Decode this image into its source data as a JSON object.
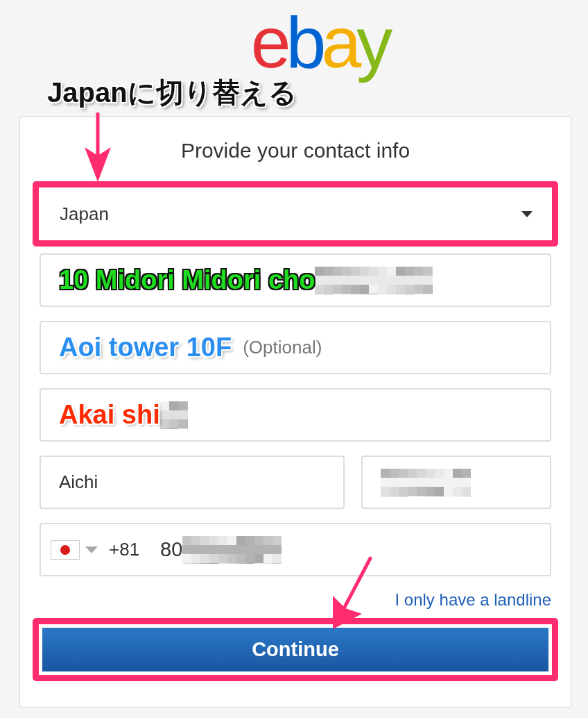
{
  "logo": {
    "letters": [
      {
        "text": "e",
        "color": "#e53238"
      },
      {
        "text": "b",
        "color": "#0064d2"
      },
      {
        "text": "a",
        "color": "#f5af02"
      },
      {
        "text": "y",
        "color": "#86b817"
      }
    ]
  },
  "annotation_title": "Japanに切り替える",
  "title": "Provide your contact info",
  "country_select": {
    "value": "Japan",
    "highlighted": true
  },
  "address_fields": [
    {
      "annotation": {
        "text": "10 Midori Midori cho",
        "color": "#1fdd1f"
      },
      "blurred": true
    },
    {
      "annotation": {
        "text": "Aoi tower 10F",
        "color": "#2b8ff0"
      },
      "placeholder": "(Optional)",
      "blurred": false
    },
    {
      "annotation": {
        "text": "Akai shi",
        "color": "#ff2a00"
      },
      "blurred": true
    }
  ],
  "state_field": {
    "value": "Aichi"
  },
  "postal_field": {
    "blurred": true
  },
  "phone": {
    "code": "+81",
    "value": "80",
    "blurred": true
  },
  "landline_link": "I only have a landline",
  "continue_button": {
    "label": "Continue",
    "highlighted": true
  }
}
